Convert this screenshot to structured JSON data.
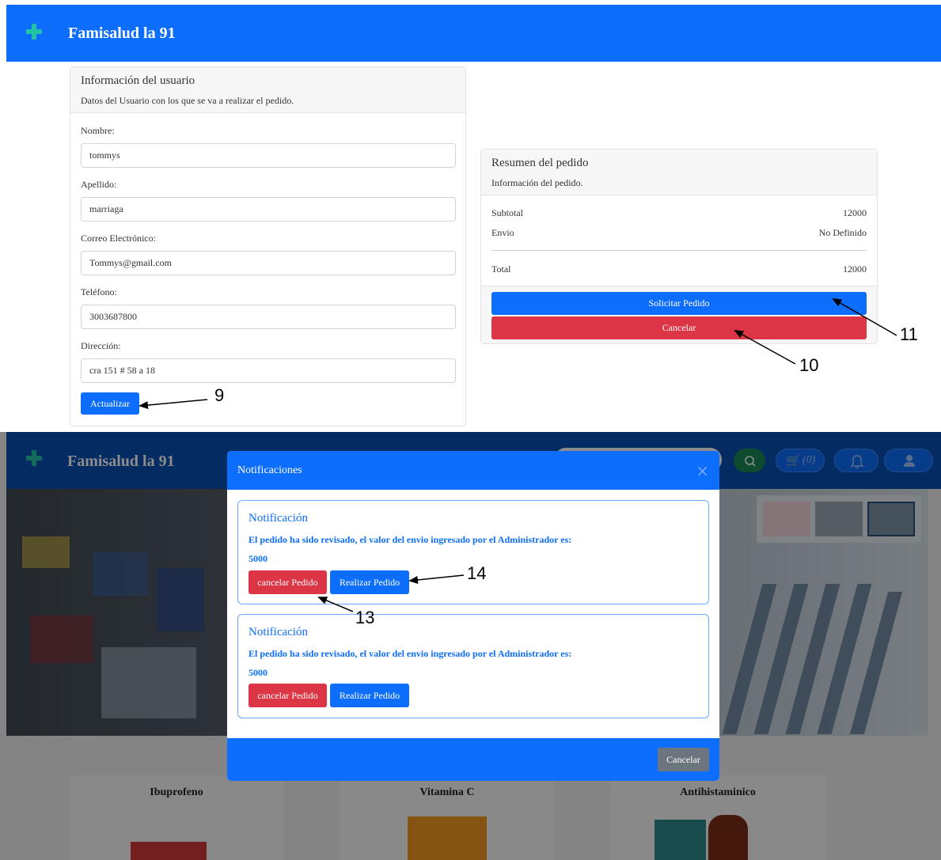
{
  "brand": "Famisalud la 91",
  "user_card": {
    "title": "Información del usuario",
    "subtitle": "Datos del Usuario con los que se va a realizar el pedido.",
    "fields": [
      {
        "label": "Nombre:",
        "value": "tommys"
      },
      {
        "label": "Apellido:",
        "value": "marriaga"
      },
      {
        "label": "Correo Electrónico:",
        "value": "Tommys@gmail.com"
      },
      {
        "label": "Teléfono:",
        "value": "3003687800"
      },
      {
        "label": "Dirección:",
        "value": "cra 151 # 58 a 18"
      }
    ],
    "update_label": "Actualizar"
  },
  "summary": {
    "title": "Resumen del pedido",
    "subtitle": "Información del pedido.",
    "subtotal_label": "Subtotal",
    "subtotal_value": "12000",
    "shipping_label": "Envio",
    "shipping_value": "No Definido",
    "total_label": "Total",
    "total_value": "12000",
    "request_label": "Solicitar Pedido",
    "cancel_label": "Cancelar"
  },
  "callouts": [
    "9",
    "10",
    "11",
    "13",
    "14"
  ],
  "bottom_nav": {
    "cart_count": "(0)"
  },
  "products": [
    "Ibuprofeno",
    "Vitamina C",
    "Antihistaminico"
  ],
  "modal": {
    "title": "Notificaciones",
    "close": "×",
    "footer_cancel": "Cancelar",
    "notifications": [
      {
        "title": "Notificación",
        "text": "El pedido ha sido revisado, el valor del envio ingresado por el Administrador es:",
        "value": "5000",
        "cancel_label": "cancelar Pedido",
        "confirm_label": "Realizar Pedido"
      },
      {
        "title": "Notificación",
        "text": "El pedido ha sido revisado, el valor del envio ingresado por el Administrador es:",
        "value": "5000",
        "cancel_label": "cancelar Pedido",
        "confirm_label": "Realizar Pedido"
      }
    ]
  },
  "colors": {
    "primary": "#0d6efd",
    "danger": "#dc3545",
    "secondary": "#6c757d",
    "logo": "#22c3a6"
  }
}
